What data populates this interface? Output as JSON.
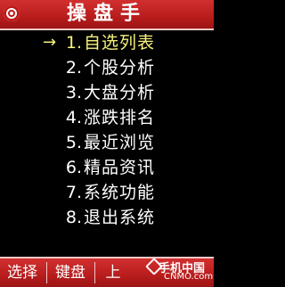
{
  "header": {
    "title": "操盘手"
  },
  "menu": {
    "selected_marker": "→",
    "items": [
      {
        "num": "1.",
        "label": "自选列表"
      },
      {
        "num": "2.",
        "label": "个股分析"
      },
      {
        "num": "3.",
        "label": "大盘分析"
      },
      {
        "num": "4.",
        "label": "涨跌排名"
      },
      {
        "num": "5.",
        "label": "最近浏览"
      },
      {
        "num": "6.",
        "label": "精品资讯"
      },
      {
        "num": "7.",
        "label": "系统功能"
      },
      {
        "num": "8.",
        "label": "退出系统"
      }
    ]
  },
  "softkeys": {
    "left": "选择",
    "middle": "键盘",
    "right": "上"
  },
  "watermark": {
    "brand": "手机中国",
    "url": "CNMO.com"
  },
  "colors": {
    "bar": "#b81c1c",
    "selected": "#f6f27a",
    "text": "#ffffff",
    "background": "#000000"
  }
}
